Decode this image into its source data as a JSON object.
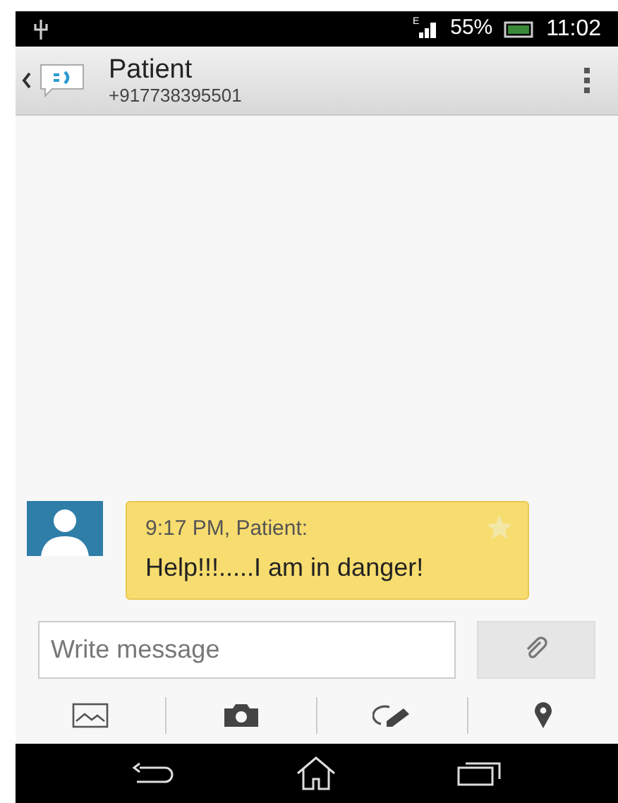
{
  "status_bar": {
    "network": "E",
    "battery": "55%",
    "time": "11:02"
  },
  "header": {
    "title": "Patient",
    "subtitle": "+917738395501"
  },
  "messages": [
    {
      "meta": "9:17 PM, Patient:",
      "text": "Help!!!.....I am in danger!",
      "starred": false
    }
  ],
  "compose": {
    "placeholder": "Write message"
  }
}
